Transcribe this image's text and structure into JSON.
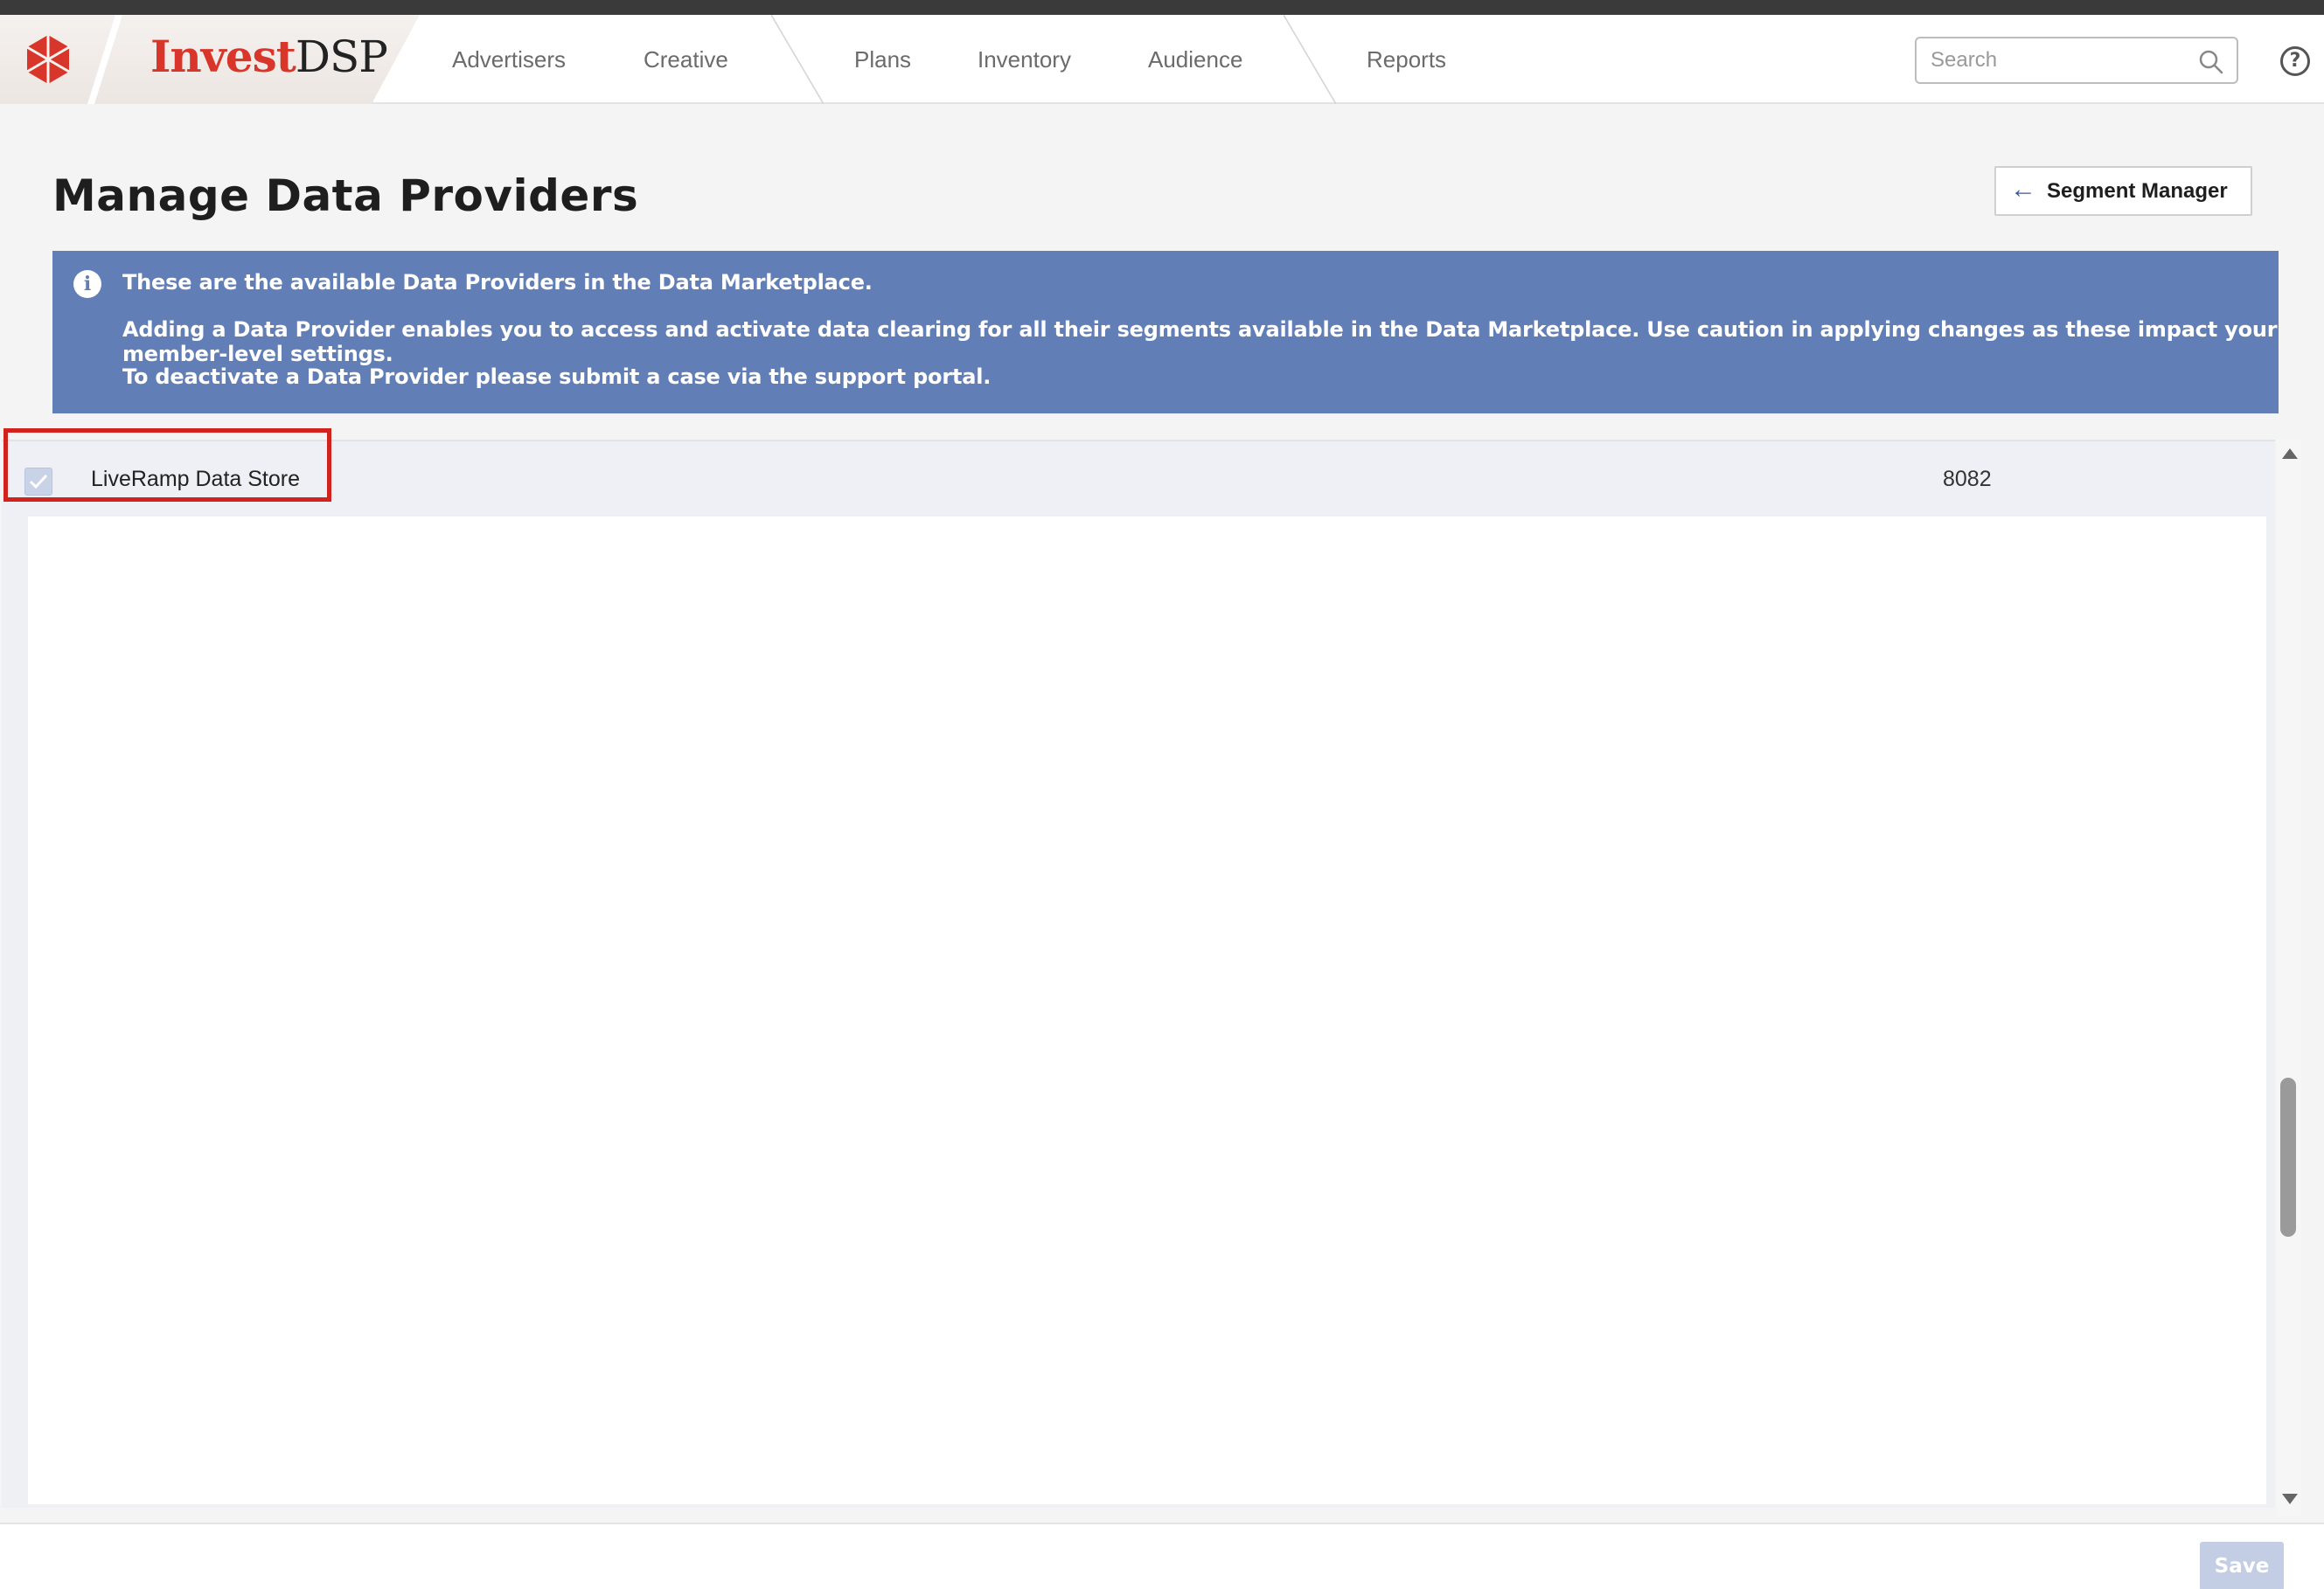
{
  "brand": {
    "part1": "Invest",
    "part2": "DSP"
  },
  "nav": {
    "items": [
      "Advertisers",
      "Creative",
      "Plans",
      "Inventory",
      "Audience",
      "Reports"
    ]
  },
  "search": {
    "placeholder": "Search"
  },
  "help": {
    "glyph": "?"
  },
  "page": {
    "title": "Manage Data Providers",
    "back_button_label": "Segment Manager"
  },
  "banner": {
    "lines": [
      "These are the available Data Providers in the Data Marketplace.",
      "Adding a Data Provider enables you to access and activate data clearing for all their segments available in the Data Marketplace. Use caution in applying changes as these impact your member-level settings.",
      "To deactivate a Data Provider please submit a case via the support portal."
    ]
  },
  "providers": [
    {
      "name": "LiveRamp Data Store",
      "id": "8082",
      "checked": true
    }
  ],
  "footer": {
    "save_label": "Save"
  },
  "colors": {
    "brand_red": "#d9362b",
    "banner_blue": "#627eb7",
    "highlight_red": "#d0231d",
    "save_disabled": "#c3cde3"
  }
}
